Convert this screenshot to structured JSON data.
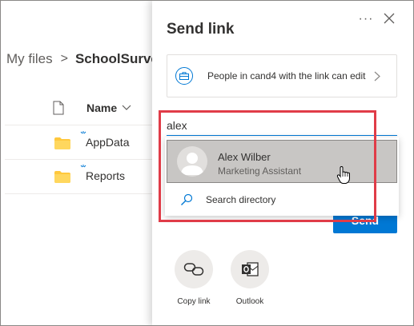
{
  "breadcrumb": {
    "root": "My files",
    "separator": ">",
    "current": "SchoolSurve"
  },
  "list": {
    "column_name": "Name",
    "items": [
      {
        "name": "AppData",
        "icon": "folder-icon"
      },
      {
        "name": "Reports",
        "icon": "folder-icon"
      }
    ]
  },
  "panel": {
    "title": "Send link",
    "more_label": "···",
    "link_settings_text": "People in cand4 with the link can edit",
    "input_value": "alex",
    "suggestion": {
      "name": "Alex Wilber",
      "title": "Marketing Assistant"
    },
    "search_directory": "Search directory",
    "send_label": "Send",
    "actions": [
      {
        "label": "Copy link",
        "icon": "link-icon"
      },
      {
        "label": "Outlook",
        "icon": "outlook-icon"
      }
    ]
  },
  "colors": {
    "accent": "#0078d4",
    "highlight": "#e03c48",
    "folder": "#ffc83d"
  }
}
